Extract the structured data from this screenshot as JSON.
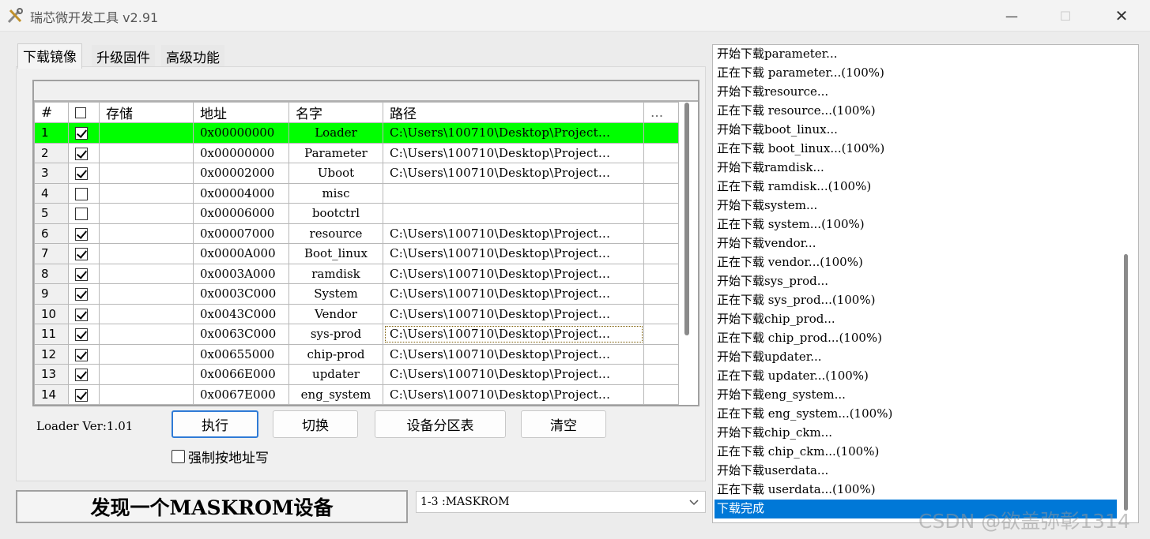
{
  "window": {
    "title": "瑞芯微开发工具 v2.91",
    "min_glyph": "—",
    "max_glyph": "☐",
    "close_glyph": "✕"
  },
  "tabs": [
    {
      "label": "下载镜像",
      "active": true
    },
    {
      "label": "升级固件",
      "active": false
    },
    {
      "label": "高级功能",
      "active": false
    }
  ],
  "table": {
    "headers": {
      "num": "#",
      "check": "☐",
      "storage": "存储",
      "address": "地址",
      "name": "名字",
      "path": "路径",
      "more": "..."
    },
    "rows": [
      {
        "num": "1",
        "checked": true,
        "storage": "",
        "address": "0x00000000",
        "name": "Loader",
        "path": "C:\\Users\\100710\\Desktop\\Project..."
      },
      {
        "num": "2",
        "checked": true,
        "storage": "",
        "address": "0x00000000",
        "name": "Parameter",
        "path": "C:\\Users\\100710\\Desktop\\Project..."
      },
      {
        "num": "3",
        "checked": true,
        "storage": "",
        "address": "0x00002000",
        "name": "Uboot",
        "path": "C:\\Users\\100710\\Desktop\\Project..."
      },
      {
        "num": "4",
        "checked": false,
        "storage": "",
        "address": "0x00004000",
        "name": "misc",
        "path": ""
      },
      {
        "num": "5",
        "checked": false,
        "storage": "",
        "address": "0x00006000",
        "name": "bootctrl",
        "path": ""
      },
      {
        "num": "6",
        "checked": true,
        "storage": "",
        "address": "0x00007000",
        "name": "resource",
        "path": "C:\\Users\\100710\\Desktop\\Project..."
      },
      {
        "num": "7",
        "checked": true,
        "storage": "",
        "address": "0x0000A000",
        "name": "Boot_linux",
        "path": "C:\\Users\\100710\\Desktop\\Project..."
      },
      {
        "num": "8",
        "checked": true,
        "storage": "",
        "address": "0x0003A000",
        "name": "ramdisk",
        "path": "C:\\Users\\100710\\Desktop\\Project..."
      },
      {
        "num": "9",
        "checked": true,
        "storage": "",
        "address": "0x0003C000",
        "name": "System",
        "path": "C:\\Users\\100710\\Desktop\\Project..."
      },
      {
        "num": "10",
        "checked": true,
        "storage": "",
        "address": "0x0043C000",
        "name": "Vendor",
        "path": "C:\\Users\\100710\\Desktop\\Project..."
      },
      {
        "num": "11",
        "checked": true,
        "storage": "",
        "address": "0x0063C000",
        "name": "sys-prod",
        "path": "C:\\Users\\100710\\Desktop\\Project..."
      },
      {
        "num": "12",
        "checked": true,
        "storage": "",
        "address": "0x00655000",
        "name": "chip-prod",
        "path": "C:\\Users\\100710\\Desktop\\Project..."
      },
      {
        "num": "13",
        "checked": true,
        "storage": "",
        "address": "0x0066E000",
        "name": "updater",
        "path": "C:\\Users\\100710\\Desktop\\Project..."
      },
      {
        "num": "14",
        "checked": true,
        "storage": "",
        "address": "0x0067E000",
        "name": "eng_system",
        "path": "C:\\Users\\100710\\Desktop\\Project..."
      }
    ],
    "selected_row": "1",
    "selected_color": "#00ff00"
  },
  "controls": {
    "loader_ver": "Loader Ver:1.01",
    "exec_label": "执行",
    "switch_label": "切换",
    "partition_label": "设备分区表",
    "clear_label": "清空",
    "force_write_label": "强制按地址写"
  },
  "status": {
    "message": "发现一个MASKROM设备",
    "device": "1-3 :MASKROM"
  },
  "log": {
    "lines": [
      "开始下载parameter...",
      "正在下载 parameter...(100%)",
      "开始下载resource...",
      "正在下载 resource...(100%)",
      "开始下载boot_linux...",
      "正在下载 boot_linux...(100%)",
      "开始下载ramdisk...",
      "正在下载 ramdisk...(100%)",
      "开始下载system...",
      "正在下载 system...(100%)",
      "开始下载vendor...",
      "正在下载 vendor...(100%)",
      "开始下载sys_prod...",
      "正在下载 sys_prod...(100%)",
      "开始下载chip_prod...",
      "正在下载 chip_prod...(100%)",
      "开始下载updater...",
      "正在下载 updater...(100%)",
      "开始下载eng_system...",
      "正在下载 eng_system...(100%)",
      "开始下载chip_ckm...",
      "正在下载 chip_ckm...(100%)",
      "开始下载userdata...",
      "正在下载 userdata...(100%)",
      "下载完成"
    ],
    "highlight_color": "#0078d7"
  },
  "watermark": "CSDN @欲盖弥彰1314"
}
